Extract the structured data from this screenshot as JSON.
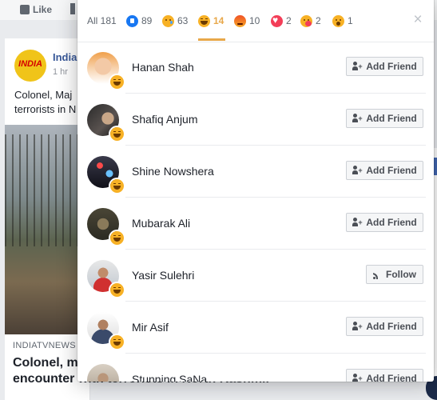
{
  "background": {
    "like_label": "Like",
    "page_name": "India",
    "avatar_text": "INDIA",
    "time": "1 hr",
    "caption": "Colonel, Maj terrorists in N",
    "domain": "INDIATVNEWS",
    "headline_line1": "Colonel, m",
    "headline_line2": "encounter with terrorists in North Kashmir"
  },
  "reactions_dialog": {
    "tabs": [
      {
        "label": "All 181",
        "icon": "",
        "active": false
      },
      {
        "label": "89",
        "icon": "like-icon",
        "active": false
      },
      {
        "label": "63",
        "icon": "sad-icon",
        "active": false
      },
      {
        "label": "14",
        "icon": "haha-icon",
        "active": true
      },
      {
        "label": "10",
        "icon": "angry-icon",
        "active": false
      },
      {
        "label": "2",
        "icon": "love-icon",
        "active": false
      },
      {
        "label": "2",
        "icon": "care-icon",
        "active": false
      },
      {
        "label": "1",
        "icon": "wow-icon",
        "active": false
      }
    ],
    "close_label": "×",
    "accent_color": "#e8a84a",
    "people": [
      {
        "name": "Hanan Shah",
        "button": "Add Friend",
        "button_type": "add-friend",
        "reaction": "haha-icon"
      },
      {
        "name": "Shafiq Anjum",
        "button": "Add Friend",
        "button_type": "add-friend",
        "reaction": "haha-icon"
      },
      {
        "name": "Shine Nowshera",
        "button": "Add Friend",
        "button_type": "add-friend",
        "reaction": "haha-icon"
      },
      {
        "name": "Mubarak Ali",
        "button": "Add Friend",
        "button_type": "add-friend",
        "reaction": "haha-icon"
      },
      {
        "name": "Yasir Sulehri",
        "button": "Follow",
        "button_type": "follow",
        "reaction": "haha-icon"
      },
      {
        "name": "Mir Asif",
        "button": "Add Friend",
        "button_type": "add-friend",
        "reaction": "haha-icon"
      },
      {
        "name": "Stunning SaNa",
        "button": "Add Friend",
        "button_type": "add-friend",
        "reaction": "haha-icon"
      }
    ]
  }
}
